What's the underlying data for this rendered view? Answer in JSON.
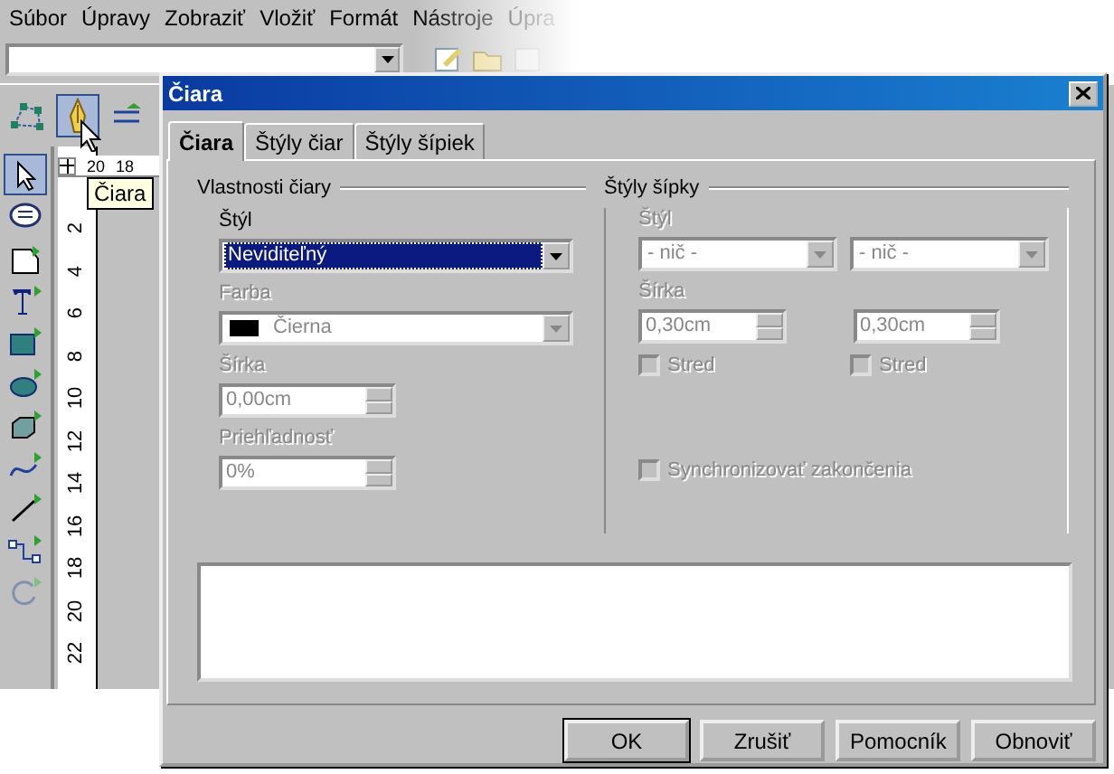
{
  "menu_bar": [
    {
      "label": "Súbor"
    },
    {
      "label": "Úpravy"
    },
    {
      "label": "Zobraziť"
    },
    {
      "label": "Vložiť"
    },
    {
      "label": "Formát"
    },
    {
      "label": "Nástroje"
    },
    {
      "label": "Úpra"
    }
  ],
  "top_tools": [
    {
      "kind": "points",
      "selected": false
    },
    {
      "kind": "pencil",
      "selected": true
    },
    {
      "kind": "connector",
      "selected": false
    }
  ],
  "tooltip": "Čiara",
  "top_ruler": [
    "20",
    "18"
  ],
  "left_tools": [
    {
      "kind": "pointer",
      "selected": true
    },
    {
      "kind": "bubble",
      "selected": false
    },
    {
      "kind": "shape",
      "selected": false
    },
    {
      "kind": "text",
      "selected": false
    },
    {
      "kind": "rect",
      "selected": false
    },
    {
      "kind": "ellipse",
      "selected": false
    },
    {
      "kind": "cube",
      "selected": false
    },
    {
      "kind": "curve",
      "selected": false
    },
    {
      "kind": "line",
      "selected": false
    },
    {
      "kind": "connector",
      "selected": false
    },
    {
      "kind": "rotate",
      "selected": false
    }
  ],
  "left_ruler": [
    "2",
    "4",
    "6",
    "8",
    "10",
    "12",
    "14",
    "16",
    "18",
    "20",
    "22"
  ],
  "dialog": {
    "title": "Čiara",
    "tabs": [
      {
        "label": "Čiara",
        "selected": true
      },
      {
        "label": "Štýly čiar",
        "selected": false
      },
      {
        "label": "Štýly šípiek",
        "selected": false
      }
    ],
    "line_properties": {
      "title": "Vlastnosti čiary",
      "fields": [
        {
          "kind": "select",
          "label": "Štýl",
          "value": "Neviditeľný",
          "disabled": false,
          "focused": true
        },
        {
          "kind": "color",
          "label": "Farba",
          "value": "Čierna",
          "color": "#000000",
          "disabled": true,
          "focused": false
        },
        {
          "kind": "spin",
          "label": "Šírka",
          "value": "0,00cm",
          "disabled": true
        },
        {
          "kind": "spin",
          "label": "Priehľadnosť",
          "value": "0%",
          "disabled": true
        }
      ]
    },
    "arrow_styles": {
      "title": "Štýly šípky",
      "disabled": true,
      "style_label": "Štýl",
      "styles": [
        "- nič -",
        "- nič -"
      ],
      "width_label": "Šírka",
      "widths": [
        "0,30cm",
        "0,30cm"
      ],
      "centers": [
        {
          "label": "Stred",
          "checked": false
        },
        {
          "label": "Stred",
          "checked": false
        }
      ],
      "sync": {
        "label": "Synchronizovať zakončenia",
        "checked": false
      }
    },
    "buttons": [
      {
        "label": "OK",
        "default": true
      },
      {
        "label": "Zrušiť",
        "default": false
      },
      {
        "label": "Pomocník",
        "default": false
      },
      {
        "label": "Obnoviť",
        "default": false
      }
    ]
  }
}
